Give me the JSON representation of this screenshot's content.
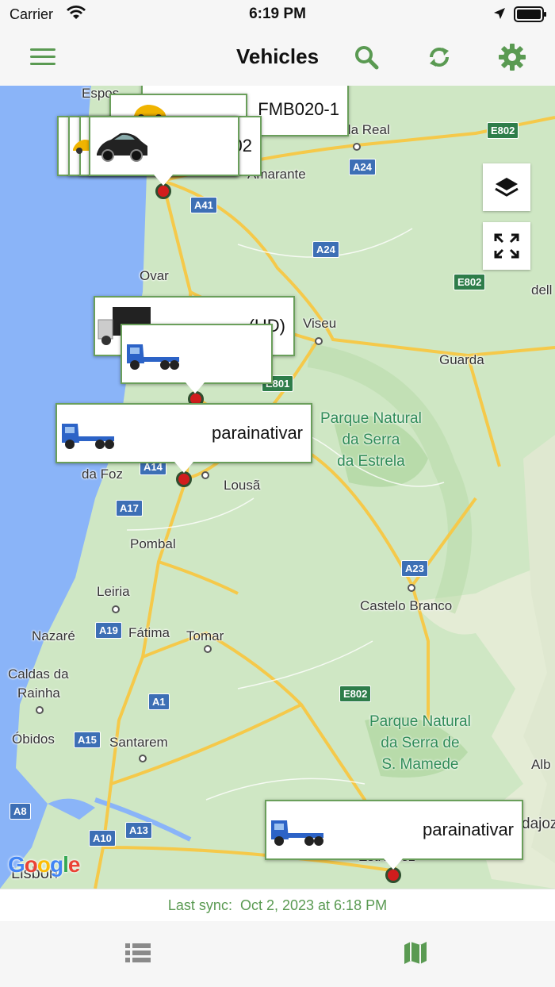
{
  "status_bar": {
    "carrier": "Carrier",
    "time": "6:19 PM"
  },
  "nav": {
    "title": "Vehicles",
    "menu_icon": "hamburger-menu-icon",
    "search_icon": "search-icon",
    "sync_icon": "refresh-icon",
    "settings_icon": "gear-icon"
  },
  "map": {
    "places": [
      "Espos",
      "Vila Real",
      "Amarante",
      "Ovar",
      "Viseu",
      "Guarda",
      "da Foz",
      "Lousã",
      "Pombal",
      "Leiria",
      "Nazaré",
      "Fátima",
      "Tomar",
      "Castelo Branco",
      "Caldas da",
      "Rainha",
      "Óbidos",
      "Santarem",
      "Lisbon",
      "Alb",
      "dajoz",
      "Estremoz",
      "dell"
    ],
    "parks": [
      "Parque Natural\nda Serra\nda Estrela",
      "Parque Natural\nda Serra de\nS. Mamede"
    ],
    "roads": [
      "E802",
      "A24",
      "A41",
      "A24",
      "E802",
      "E801",
      "A14",
      "A17",
      "A23",
      "A19",
      "E802",
      "A1",
      "A15",
      "A8",
      "A13",
      "A10"
    ],
    "layers_icon": "layers-icon",
    "fullscreen_icon": "fullscreen-icon",
    "callouts": [
      {
        "label": "FMB020-1",
        "icon": "yellow-car-icon"
      },
      {
        "label": "02",
        "icon": "car-icon"
      },
      {
        "label": "(HD)",
        "icon": "van-truck-icon"
      },
      {
        "label": "",
        "icon": "flatbed-truck-icon"
      },
      {
        "label": "parainativar",
        "icon": "flatbed-truck-icon"
      },
      {
        "label": "parainativar",
        "icon": "flatbed-truck-icon"
      }
    ],
    "google_logo": "Google"
  },
  "sync": {
    "label": "Last sync:",
    "value": "Oct 2, 2023 at 6:18 PM"
  },
  "tabs": [
    {
      "icon": "list-icon",
      "active": false
    },
    {
      "icon": "map-icon",
      "active": true
    }
  ],
  "colors": {
    "accent": "#5a9a52",
    "pin": "#d11d1d",
    "water": "#8ab4f8",
    "land": "#cfe7c4"
  }
}
